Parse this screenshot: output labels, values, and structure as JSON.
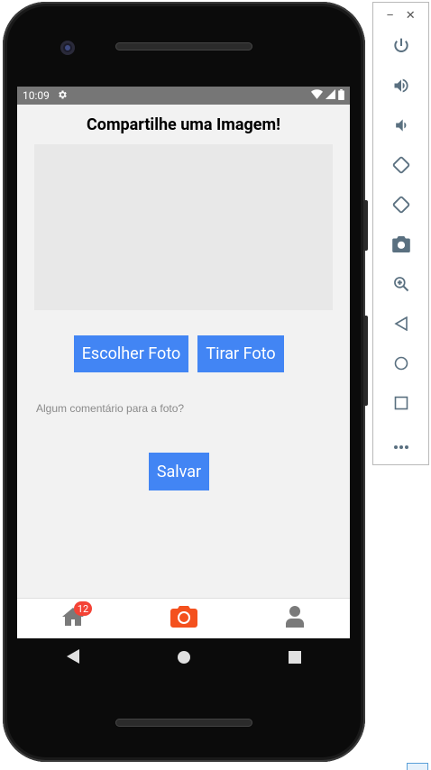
{
  "status_bar": {
    "time": "10:09"
  },
  "app": {
    "title": "Compartilhe uma Imagem!",
    "buttons": {
      "choose_photo": "Escolher Foto",
      "take_photo": "Tirar Foto",
      "save": "Salvar"
    },
    "comment_placeholder": "Algum comentário para a foto?",
    "comment_value": ""
  },
  "tab_bar": {
    "tabs": [
      {
        "icon": "home-icon",
        "badge": "12",
        "active": false
      },
      {
        "icon": "camera-icon",
        "active": true
      },
      {
        "icon": "user-icon",
        "active": false
      }
    ],
    "active_color": "#f4511e",
    "inactive_color": "#7a7a7a",
    "badge_color": "#f44336"
  },
  "nav_bar": {
    "buttons": [
      "back-icon",
      "home-circle-icon",
      "recents-icon"
    ]
  },
  "emulator_toolbar": {
    "window_controls": [
      "minimize-icon",
      "close-icon"
    ],
    "buttons": [
      "power-icon",
      "volume-up-icon",
      "volume-down-icon",
      "rotate-left-icon",
      "rotate-right-icon",
      "screenshot-icon",
      "zoom-icon",
      "back-icon",
      "home-icon",
      "overview-icon",
      "more-icon"
    ]
  },
  "colors": {
    "primary_button": "#4285f4",
    "screen_bg": "#f2f2f2",
    "image_placeholder": "#e8e8e8"
  }
}
